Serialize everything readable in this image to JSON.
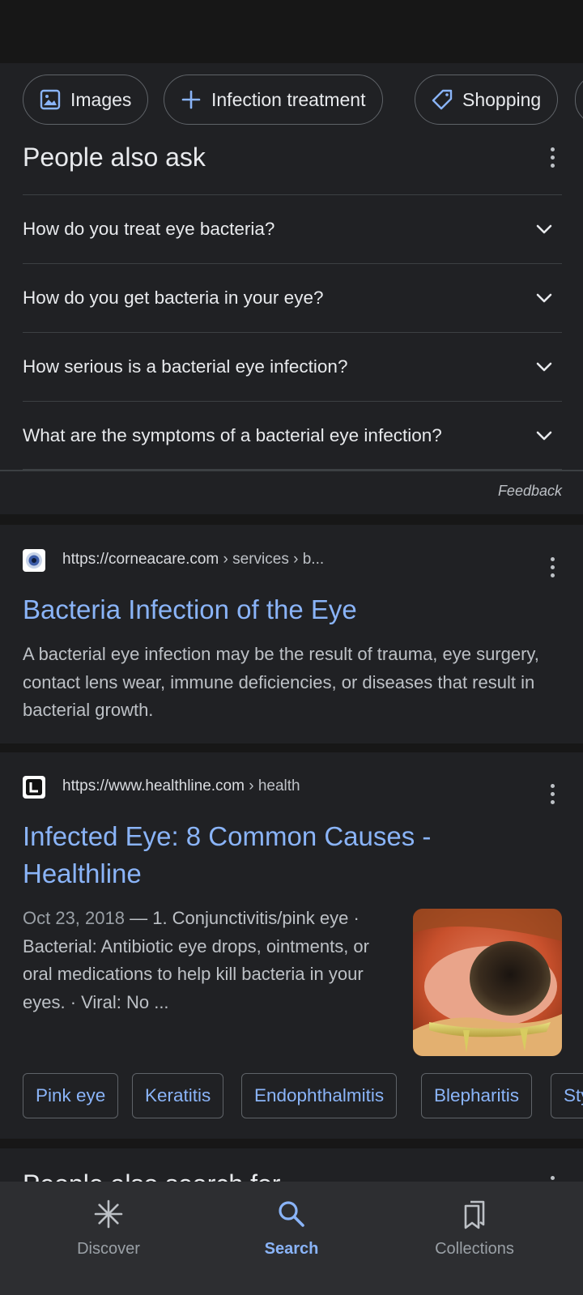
{
  "chips": [
    {
      "label": "Images",
      "icon": "image-icon"
    },
    {
      "label": "Infection treatment",
      "icon": "plus-icon"
    },
    {
      "label": "Shopping",
      "icon": "tag-icon"
    }
  ],
  "people_also_ask": {
    "title": "People also ask",
    "questions": [
      "How do you treat eye bacteria?",
      "How do you get bacteria in your eye?",
      "How serious is a bacterial eye infection?",
      "What are the symptoms of a bacterial eye infection?"
    ],
    "feedback": "Feedback"
  },
  "results": [
    {
      "url": "https://corneacare.com",
      "crumb": " › services › b...",
      "title": "Bacteria Infection of the Eye",
      "snippet": "A bacterial eye infection may be the result of trauma, eye surgery, contact lens wear, immune deficiencies, or diseases that result in bacterial growth."
    },
    {
      "url": "https://www.healthline.com",
      "crumb": " › health",
      "title": "Infected Eye: 8 Common Causes - Healthline",
      "date": "Oct 23, 2018",
      "snippet": " — 1. Conjunctivitis/pink eye · Bacterial: Antibiotic eye drops, ointments, or oral medications to help kill bacteria in your eyes. · Viral: No ...",
      "tags": [
        "Pink eye",
        "Keratitis",
        "Endophthalmitis",
        "Blepharitis",
        "Sty"
      ]
    }
  ],
  "next_section_heading": "People also search for",
  "bottom_nav": [
    {
      "label": "Discover",
      "icon": "asterisk-icon"
    },
    {
      "label": "Search",
      "icon": "search-icon"
    },
    {
      "label": "Collections",
      "icon": "collections-icon"
    }
  ],
  "colors": {
    "accent": "#8ab4f8",
    "background": "#202124",
    "text": "#e8eaed"
  }
}
